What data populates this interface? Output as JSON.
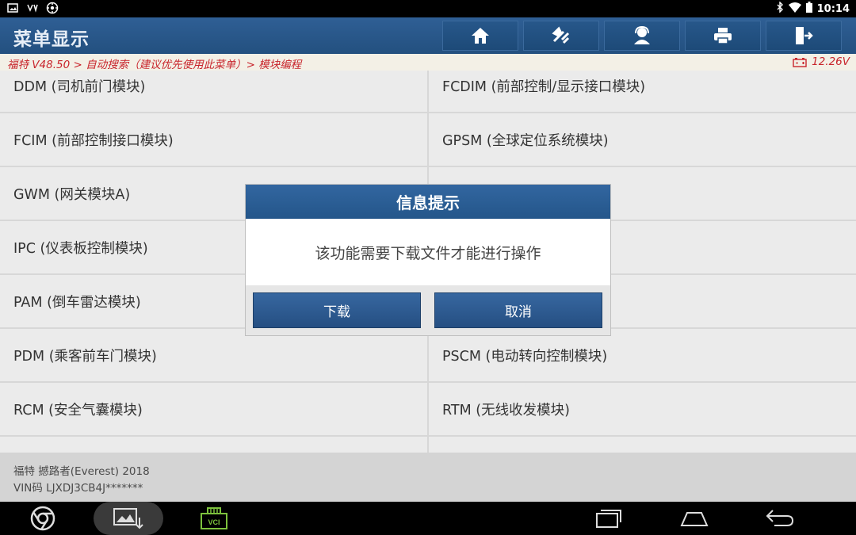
{
  "status_bar": {
    "left_icons": [
      "image-icon",
      "usb-icon",
      "settings-gear-icon"
    ],
    "right_icons": [
      "bluetooth-icon",
      "wifi-icon",
      "battery-icon"
    ],
    "time": "10:14"
  },
  "header": {
    "title": "菜单显示",
    "toolbar_icons": [
      "home-icon",
      "diagnose-tools-icon",
      "support-person-icon",
      "print-icon",
      "exit-icon"
    ]
  },
  "breadcrumb": {
    "text": "福特 V48.50 > 自动搜索（建议优先使用此菜单）> 模块编程",
    "voltage": "12.26V"
  },
  "modules": [
    [
      "DDM (司机前门模块)",
      "FCDIM (前部控制/显示接口模块)"
    ],
    [
      "FCIM (前部控制接口模块)",
      "GPSM (全球定位系统模块)"
    ],
    [
      "GWM (网关模块A)",
      ""
    ],
    [
      "IPC (仪表板控制模块)",
      ""
    ],
    [
      "PAM (倒车雷达模块)",
      ""
    ],
    [
      "PDM (乘客前车门模块)",
      "PSCM (电动转向控制模块)"
    ],
    [
      "RCM (安全气囊模块)",
      "RTM (无线收发模块)"
    ]
  ],
  "vehicle_info": {
    "line1": "福特 撼路者(Everest) 2018",
    "line2": "VIN码 LJXDJ3CB4J*******"
  },
  "dialog": {
    "title": "信息提示",
    "message": "该功能需要下载文件才能进行操作",
    "confirm_label": "下载",
    "cancel_label": "取消"
  },
  "nav_bar": {
    "left_icons": [
      "chrome-icon",
      "screenshot-icon",
      "vci-icon"
    ],
    "vci_label": "VCI",
    "right_icons": [
      "recent-apps-icon",
      "home-nav-icon",
      "back-icon"
    ]
  }
}
